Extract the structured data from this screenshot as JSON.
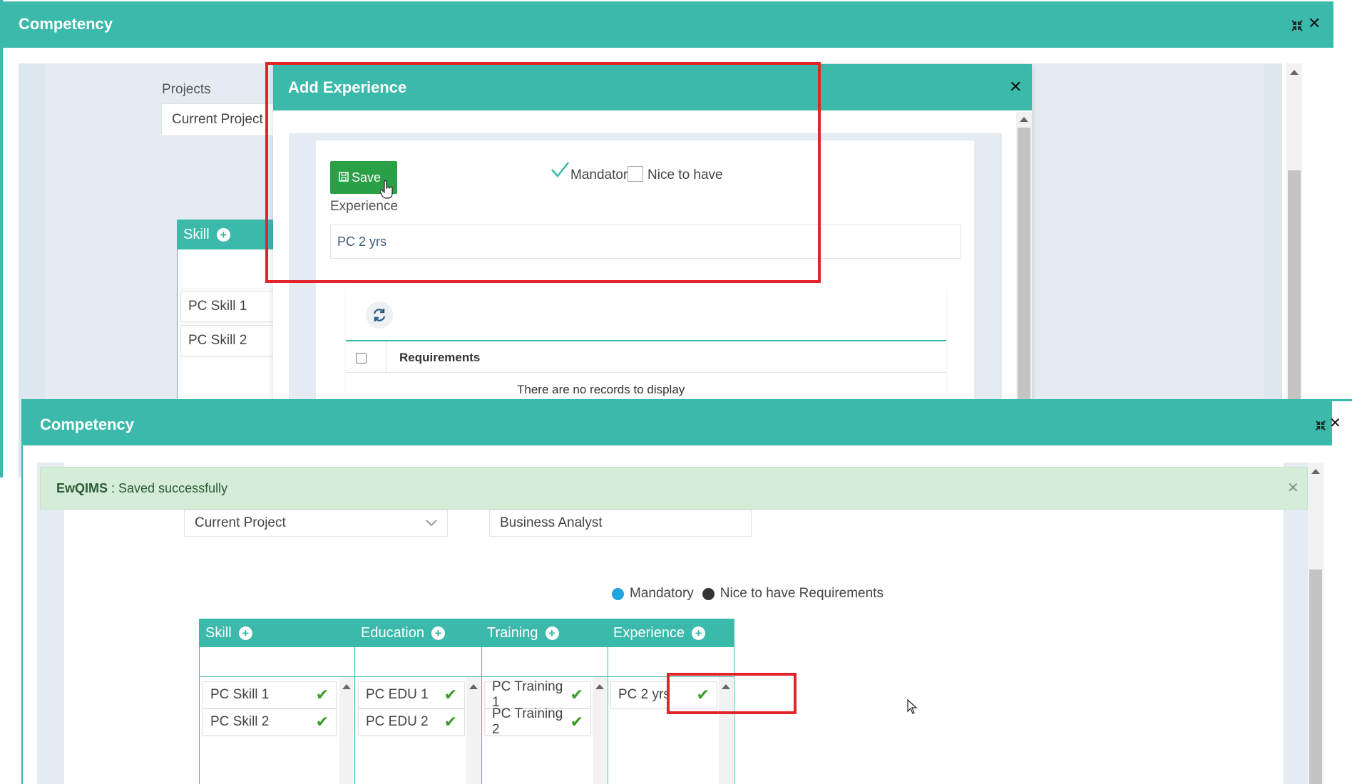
{
  "top_window": {
    "title": "Competency",
    "projects_label": "Projects",
    "project_value": "Current Project",
    "skill_header": "Skill",
    "skills": [
      "PC Skill 1",
      "PC Skill 2"
    ]
  },
  "add_experience_modal": {
    "title": "Add Experience",
    "save_label": "Save",
    "mandatory_label": "Mandatory",
    "nice_to_have_label": "Nice to have",
    "experience_label": "Experience",
    "experience_value": "PC 2 yrs",
    "requirements_header": "Requirements",
    "no_records_text": "There are no records to display"
  },
  "bottom_window": {
    "title": "Competency",
    "alert_app": "EwQIMS",
    "alert_message": " : Saved successfully",
    "project_value": "Current Project",
    "role_value": "Business Analyst",
    "legend_mandatory": "Mandatory",
    "legend_nice": "Nice to have Requirements",
    "columns": [
      {
        "header": "Skill",
        "items": [
          "PC Skill 1",
          "PC Skill 2"
        ]
      },
      {
        "header": "Education",
        "items": [
          "PC EDU 1",
          "PC EDU 2"
        ]
      },
      {
        "header": "Training",
        "items": [
          "PC Training 1",
          "PC Training 2"
        ]
      },
      {
        "header": "Experience",
        "items": [
          "PC 2 yrs"
        ]
      }
    ]
  },
  "colors": {
    "teal": "#3bb9aa",
    "save_green": "#29a046",
    "highlight_red": "#e3242b",
    "success_bg": "#d5ecd8",
    "mandatory_dot": "#1fa4e0",
    "nice_dot": "#333333"
  }
}
